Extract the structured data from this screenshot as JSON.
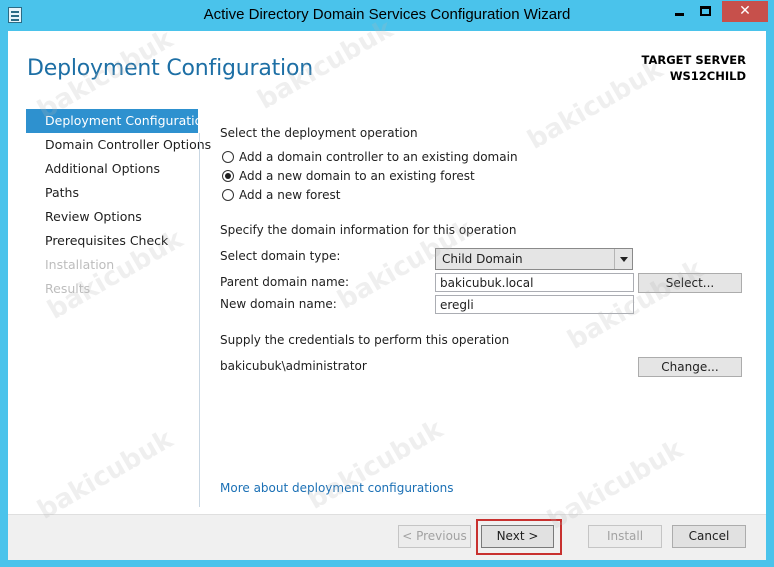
{
  "window": {
    "title": "Active Directory Domain Services Configuration Wizard",
    "close_glyph": "✕"
  },
  "header": {
    "page_title": "Deployment Configuration",
    "target_label": "TARGET SERVER",
    "target_name": "WS12CHILD"
  },
  "nav": {
    "items": [
      {
        "label": "Deployment Configuration",
        "state": "active"
      },
      {
        "label": "Domain Controller Options",
        "state": "enabled"
      },
      {
        "label": "Additional Options",
        "state": "enabled"
      },
      {
        "label": "Paths",
        "state": "enabled"
      },
      {
        "label": "Review Options",
        "state": "enabled"
      },
      {
        "label": "Prerequisites Check",
        "state": "enabled"
      },
      {
        "label": "Installation",
        "state": "disabled"
      },
      {
        "label": "Results",
        "state": "disabled"
      }
    ]
  },
  "operation": {
    "heading": "Select the deployment operation",
    "options": [
      {
        "label": "Add a domain controller to an existing domain",
        "selected": false
      },
      {
        "label": "Add a new domain to an existing forest",
        "selected": true
      },
      {
        "label": "Add a new forest",
        "selected": false
      }
    ]
  },
  "domain_info": {
    "heading": "Specify the domain information for this operation",
    "type_label": "Select domain type:",
    "type_value": "Child Domain",
    "parent_label": "Parent domain name:",
    "parent_value": "bakicubuk.local",
    "select_button": "Select...",
    "new_label": "New domain name:",
    "new_value": "eregli"
  },
  "credentials": {
    "heading": "Supply the credentials to perform this operation",
    "account": "bakicubuk\\administrator",
    "change_button": "Change..."
  },
  "more_link": "More about deployment configurations",
  "footer": {
    "previous": "< Previous",
    "next": "Next >",
    "install": "Install",
    "cancel": "Cancel"
  },
  "watermark": "bakicubuk",
  "colors": {
    "titlebar": "#4ac3eb",
    "nav_active": "#2e91cf",
    "title_text": "#1d6fa5",
    "close_button": "#c7504b",
    "highlight": "#c8312f"
  }
}
